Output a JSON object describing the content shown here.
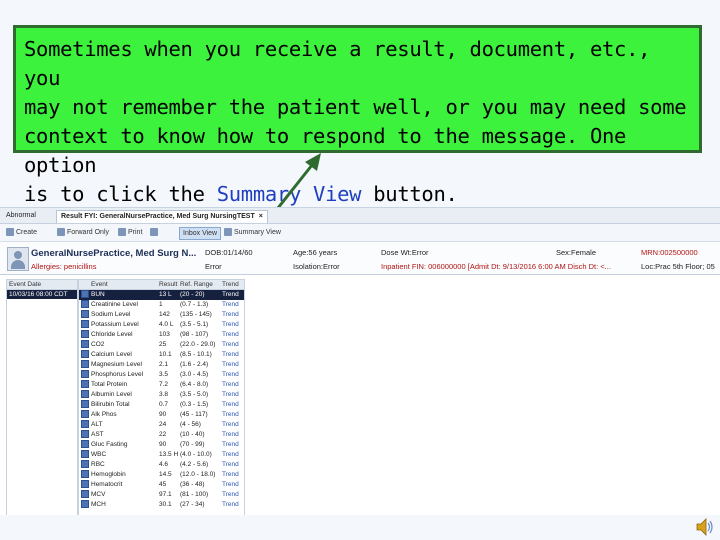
{
  "callout": {
    "line1": "Sometimes when you receive a result, document, etc., you",
    "line2": "may not remember the patient well, or you may need some",
    "line3": "context to know how to respond to the message.  One option",
    "line4_before": "is to click the ",
    "line4_highlight": "Summary View",
    "line4_after": " button."
  },
  "app": {
    "tabs": [
      {
        "label": "Abnormal"
      },
      {
        "label": "Result FYI: GeneralNursePractice, Med Surg NursingTEST"
      }
    ],
    "tab_close": "×",
    "toolbar": {
      "create": "Create",
      "forward_only": "Forward Only",
      "print": "Print",
      "inbox_view": "Inbox View",
      "summary_view": "Summary View"
    },
    "banner": {
      "name": "GeneralNursePractice, Med Surg N...",
      "allergies": "Allergies: penicillins",
      "dob": "DOB:01/14/60",
      "dob_error": "Error",
      "age": "Age:56 years",
      "isolation": "Isolation:Error",
      "dose_wt": "Dose Wt:Error",
      "sex": "Sex:Female",
      "inpatient": "Inpatient FIN: 006000000 [Admit Dt: 9/13/2016 6:00 AM Disch Dt: <...",
      "mrn": "MRN:002500000",
      "loc": "Loc:Prac 5th Floor; 05"
    },
    "grid": {
      "left_header": "Event Date",
      "left_rows": [
        "10/03/16 08:00 CDT"
      ],
      "headers": {
        "event": "Event",
        "result": "Result",
        "ref": "Ref. Range",
        "trend": "Trend"
      },
      "rows": [
        {
          "event": "BUN",
          "result": "13 L",
          "ref": "(20 - 20)",
          "trend": "Trend"
        },
        {
          "event": "Creatinine Level",
          "result": "1",
          "ref": "(0.7 - 1.3)",
          "trend": "Trend"
        },
        {
          "event": "Sodium Level",
          "result": "142",
          "ref": "(135 - 145)",
          "trend": "Trend"
        },
        {
          "event": "Potassium Level",
          "result": "4.0 L",
          "ref": "(3.5 - 5.1)",
          "trend": "Trend"
        },
        {
          "event": "Chloride Level",
          "result": "103",
          "ref": "(98 - 107)",
          "trend": "Trend"
        },
        {
          "event": "CO2",
          "result": "25",
          "ref": "(22.0 - 29.0)",
          "trend": "Trend"
        },
        {
          "event": "Calcium Level",
          "result": "10.1",
          "ref": "(8.5 - 10.1)",
          "trend": "Trend"
        },
        {
          "event": "Magnesium Level",
          "result": "2.1",
          "ref": "(1.6 - 2.4)",
          "trend": "Trend"
        },
        {
          "event": "Phosphorus Level",
          "result": "3.5",
          "ref": "(3.0 - 4.5)",
          "trend": "Trend"
        },
        {
          "event": "Total Protein",
          "result": "7.2",
          "ref": "(6.4 - 8.0)",
          "trend": "Trend"
        },
        {
          "event": "Albumin Level",
          "result": "3.8",
          "ref": "(3.5 - 5.0)",
          "trend": "Trend"
        },
        {
          "event": "Bilirubin Total",
          "result": "0.7",
          "ref": "(0.3 - 1.5)",
          "trend": "Trend"
        },
        {
          "event": "Alk Phos",
          "result": "90",
          "ref": "(45 - 117)",
          "trend": "Trend"
        },
        {
          "event": "ALT",
          "result": "24",
          "ref": "(4 - 56)",
          "trend": "Trend"
        },
        {
          "event": "AST",
          "result": "22",
          "ref": "(10 - 40)",
          "trend": "Trend"
        },
        {
          "event": "Gluc Fasting",
          "result": "90",
          "ref": "(70 - 99)",
          "trend": "Trend"
        },
        {
          "event": "WBC",
          "result": "13.5 H",
          "ref": "(4.0 - 10.0)",
          "trend": "Trend"
        },
        {
          "event": "RBC",
          "result": "4.6",
          "ref": "(4.2 - 5.6)",
          "trend": "Trend"
        },
        {
          "event": "Hemoglobin",
          "result": "14.5",
          "ref": "(12.0 - 18.0)",
          "trend": "Trend"
        },
        {
          "event": "Hematocrit",
          "result": "45",
          "ref": "(36 - 48)",
          "trend": "Trend"
        },
        {
          "event": "MCV",
          "result": "97.1",
          "ref": "(81 - 100)",
          "trend": "Trend"
        },
        {
          "event": "MCH",
          "result": "30.1",
          "ref": "(27 - 34)",
          "trend": "Trend"
        }
      ]
    }
  }
}
